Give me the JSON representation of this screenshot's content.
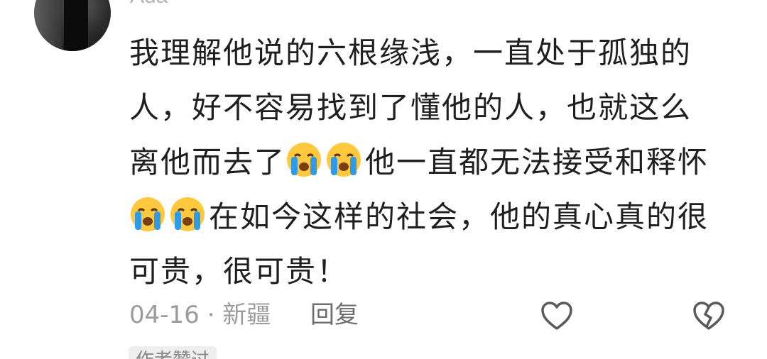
{
  "comment": {
    "username": "Ada",
    "line1": "我理解他说的六根缘浅，一直处于孤独的",
    "line2": "人，好不容易找到了懂他的人，也就这么",
    "line3_before": "离他而去了",
    "line3_after": "他一直都无法接受和释怀",
    "line4_after": "在如今这样的社会，他的真心真的很",
    "line5": "可贵，很可贵！",
    "emoji": "loudly-crying-face"
  },
  "meta": {
    "date_location": "04-16 · 新疆",
    "reply_label": "回复"
  },
  "actions": {
    "like_icon": "heart-outline-icon",
    "dislike_icon": "broken-heart-outline-icon"
  },
  "badge": {
    "label": "作者赞过"
  },
  "colors": {
    "text": "#1f1f1f",
    "meta": "#9b9b9b",
    "reply": "#6e6e6e",
    "icon": "#5a5a5a"
  }
}
